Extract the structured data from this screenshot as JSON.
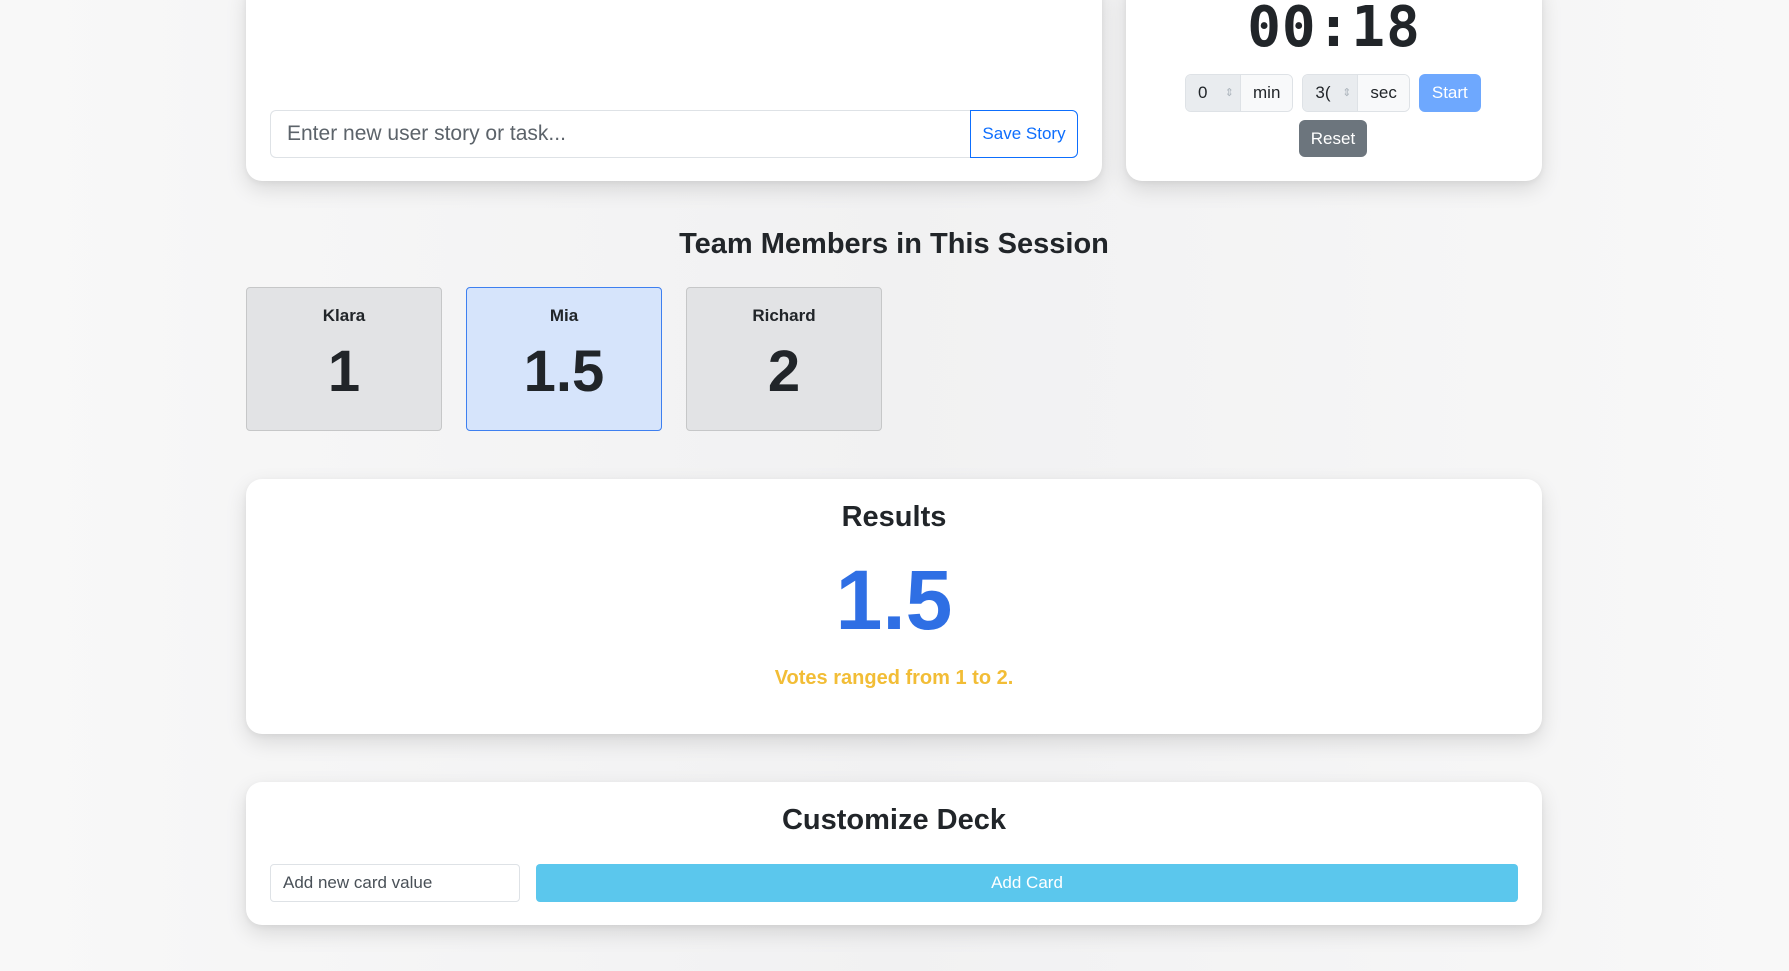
{
  "story": {
    "input_placeholder": "Enter new user story or task...",
    "input_value": "",
    "save_label": "Save Story"
  },
  "timer": {
    "display": "00:18",
    "minutes_value": "0",
    "minutes_unit": "min",
    "seconds_value": "3(",
    "seconds_unit": "sec",
    "spin_glyph": "⇕",
    "start_label": "Start",
    "reset_label": "Reset"
  },
  "team": {
    "heading": "Team Members in This Session",
    "members": [
      {
        "name": "Klara",
        "vote": "1"
      },
      {
        "name": "Mia",
        "vote": "1.5"
      },
      {
        "name": "Richard",
        "vote": "2"
      }
    ]
  },
  "results": {
    "title": "Results",
    "value": "1.5",
    "range_text": "Votes ranged from 1 to 2."
  },
  "deck": {
    "title": "Customize Deck",
    "input_placeholder": "Add new card value",
    "add_label": "Add Card"
  },
  "colors": {
    "primary": "#0d6efd",
    "result_value": "#2f6fe4",
    "range_warning": "#f2bd36",
    "add_card_button": "#5bc7ed",
    "selected_card_bg": "#d6e4fb",
    "reset_button": "#6c757d"
  }
}
